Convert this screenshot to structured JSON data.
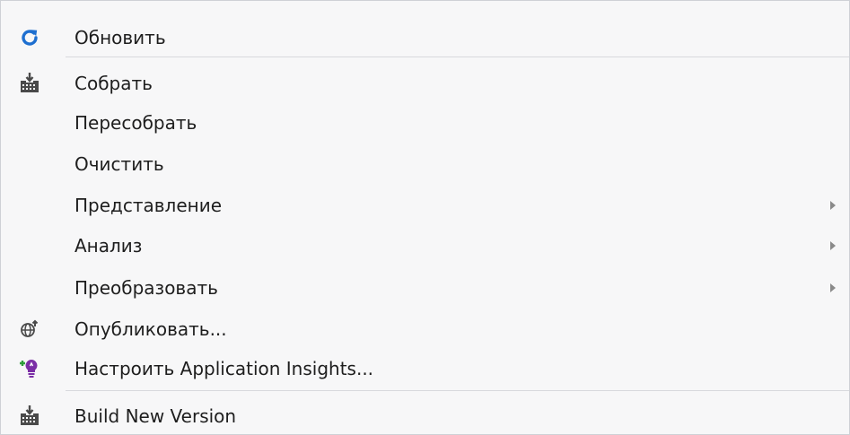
{
  "menu": {
    "items": [
      {
        "label": "Обновить",
        "icon": "refresh-icon",
        "submenu": false
      },
      {
        "label": "Собрать",
        "icon": "build-icon",
        "submenu": false
      },
      {
        "label": "Пересобрать",
        "icon": "",
        "submenu": false
      },
      {
        "label": "Очистить",
        "icon": "",
        "submenu": false
      },
      {
        "label": "Представление",
        "icon": "",
        "submenu": true
      },
      {
        "label": "Анализ",
        "icon": "",
        "submenu": true
      },
      {
        "label": "Преобразовать",
        "icon": "",
        "submenu": true
      },
      {
        "label": "Опубликовать...",
        "icon": "publish-globe-icon",
        "submenu": false
      },
      {
        "label": "Настроить Application Insights...",
        "icon": "application-insights-icon",
        "submenu": false
      },
      {
        "label": "Build New Version",
        "icon": "build-new-version-icon",
        "submenu": false
      }
    ]
  },
  "colors": {
    "background": "#f7f7f8",
    "text": "#1e1e1e",
    "refresh_blue": "#1e6fd0",
    "insights_purple": "#7b2ea6",
    "insights_green": "#2e9d3a",
    "icon_gray": "#4a4a4a"
  }
}
